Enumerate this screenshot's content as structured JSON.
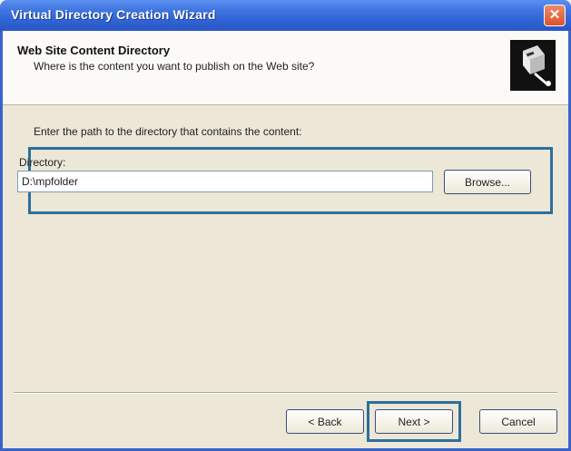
{
  "window": {
    "title": "Virtual Directory Creation Wizard",
    "close_glyph": "✕"
  },
  "header": {
    "title": "Web Site Content Directory",
    "subtitle": "Where is the content you want to publish on the Web site?",
    "icon": "wizard-icon"
  },
  "content": {
    "instruction": "Enter the path to the directory that contains the content:",
    "directory_label": "Directory:",
    "directory_value": "D:\\mpfolder",
    "browse_label": "Browse..."
  },
  "footer": {
    "back_label": "< Back",
    "next_label": "Next >",
    "cancel_label": "Cancel"
  },
  "colors": {
    "titlebar": "#2f62d4",
    "highlight": "#2c6f9e",
    "dialog": "#ece7d6"
  }
}
